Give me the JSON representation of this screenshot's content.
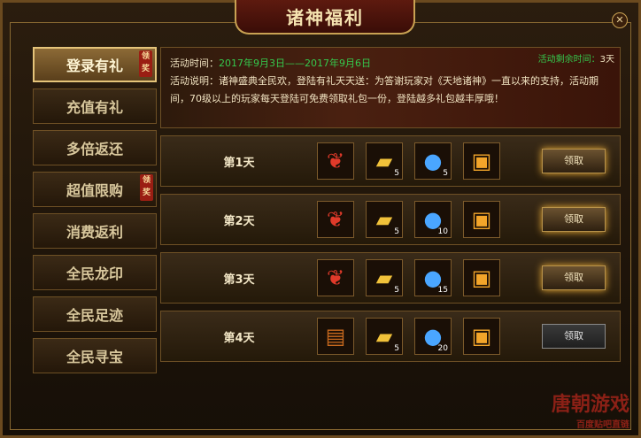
{
  "title": "诸神福利",
  "close_icon": "close-icon",
  "nav_badge_text": "领奖",
  "sidebar": {
    "items": [
      {
        "label": "登录有礼",
        "active": true,
        "badge": true
      },
      {
        "label": "充值有礼",
        "active": false,
        "badge": false
      },
      {
        "label": "多倍返还",
        "active": false,
        "badge": false
      },
      {
        "label": "超值限购",
        "active": false,
        "badge": true
      },
      {
        "label": "消费返利",
        "active": false,
        "badge": false
      },
      {
        "label": "全民龙印",
        "active": false,
        "badge": false
      },
      {
        "label": "全民足迹",
        "active": false,
        "badge": false
      },
      {
        "label": "全民寻宝",
        "active": false,
        "badge": false
      }
    ]
  },
  "activity": {
    "time_label": "活动时间：",
    "time_value": "2017年9月3日——2017年9月6日",
    "remaining_label": "活动剩余时间：",
    "remaining_value": "3天",
    "description": "活动说明：诸神盛典全民欢，登陆有礼天天送：为答谢玩家对《天地诸神》一直以来的支持，活动期间，70级以上的玩家每天登陆可免费领取礼包一份，登陆越多礼包越丰厚哦！"
  },
  "rows": [
    {
      "day": "第1天",
      "items": [
        {
          "icon": "mount-icon",
          "count": ""
        },
        {
          "icon": "gold-bars-icon",
          "count": "5"
        },
        {
          "icon": "blue-orb-icon",
          "count": "5"
        },
        {
          "icon": "gift-box-icon",
          "count": ""
        }
      ],
      "button": "领取",
      "enabled": true
    },
    {
      "day": "第2天",
      "items": [
        {
          "icon": "mount-icon",
          "count": ""
        },
        {
          "icon": "gold-bars-icon",
          "count": "5"
        },
        {
          "icon": "blue-orb-icon",
          "count": "10"
        },
        {
          "icon": "gift-box-icon",
          "count": ""
        }
      ],
      "button": "领取",
      "enabled": true
    },
    {
      "day": "第3天",
      "items": [
        {
          "icon": "mount-icon",
          "count": ""
        },
        {
          "icon": "gold-bars-icon",
          "count": "5"
        },
        {
          "icon": "blue-orb-icon",
          "count": "15"
        },
        {
          "icon": "gift-box-icon",
          "count": ""
        }
      ],
      "button": "领取",
      "enabled": true
    },
    {
      "day": "第4天",
      "items": [
        {
          "icon": "skill-book-icon",
          "count": ""
        },
        {
          "icon": "gold-bars-icon",
          "count": "5"
        },
        {
          "icon": "blue-orb-icon",
          "count": "20"
        },
        {
          "icon": "gift-box-icon",
          "count": ""
        }
      ],
      "button": "领取",
      "enabled": false
    }
  ],
  "watermark": {
    "main": "唐朝游戏",
    "sub": "百度贴吧直链"
  },
  "colors": {
    "accent_green": "#35c94d",
    "gold": "#c9a253",
    "badge_red": "#9a1e13"
  }
}
